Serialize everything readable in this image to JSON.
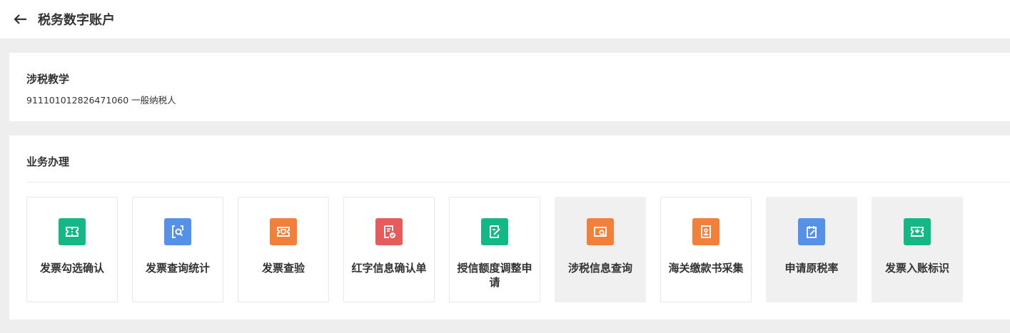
{
  "header": {
    "title": "税务数字账户"
  },
  "account": {
    "name": "涉税教学",
    "detail": "911101012826471060 一般纳税人"
  },
  "business": {
    "title": "业务办理",
    "tiles": [
      {
        "label": "发票勾选确认",
        "icon": "ticket-icon",
        "color": "#14b886",
        "gray": false
      },
      {
        "label": "发票查询统计",
        "icon": "document-search-icon",
        "color": "#5591e9",
        "gray": false
      },
      {
        "label": "发票查验",
        "icon": "ticket-shield-icon",
        "color": "#f2803a",
        "gray": false
      },
      {
        "label": "红字信息确认单",
        "icon": "document-check-icon",
        "color": "#e65b5b",
        "gray": false
      },
      {
        "label": "授信额度调整申请",
        "icon": "document-edit-icon",
        "color": "#14b886",
        "gray": false
      },
      {
        "label": "涉税信息查询",
        "icon": "folder-search-icon",
        "color": "#f2803a",
        "gray": true
      },
      {
        "label": "海关缴款书采集",
        "icon": "document-anchor-icon",
        "color": "#f2803a",
        "gray": false
      },
      {
        "label": "申请原税率",
        "icon": "notepad-edit-icon",
        "color": "#5591e9",
        "gray": true
      },
      {
        "label": "发票入账标识",
        "icon": "ticket-download-icon",
        "color": "#14b886",
        "gray": true
      }
    ]
  }
}
